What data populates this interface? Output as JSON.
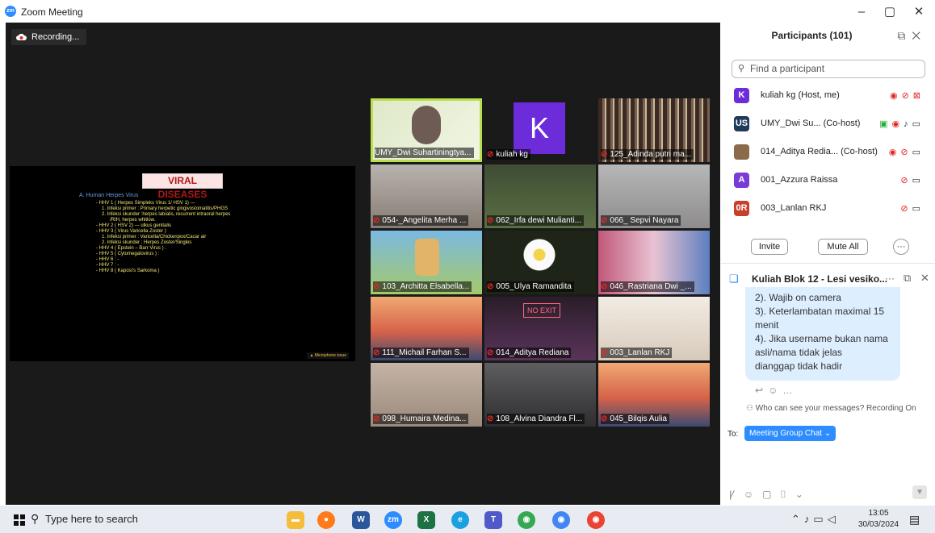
{
  "window": {
    "title": "Zoom Meeting",
    "minimize": "–",
    "maximize": "▢",
    "close": "✕"
  },
  "meeting": {
    "recording_label": "Recording...",
    "slide": {
      "title": "VIRAL DISEASES",
      "heading": "A. Human Herpes Virus",
      "lines": [
        "- HHV 1 ( Herpes Simpleks Virus 1/ HSV 1) ---",
        "1. Infeksi primer : Primary herpetic gingivostomatitis/PHGS",
        "2. Infeksi skunder :herpes labialis,  recurrent intraoral herpes",
        "/RIH, herpes whitlow.",
        "- HHV 2 ( HSV 2) --- ulkus genitalis",
        "- HHV 3 ( Virus Varicella Zoster )",
        "1. Infeksi primer : Varicella/Chickenpox/Cacar air",
        "2. Infeksi skunder : Herpes Zoster/Singles",
        "- HHV 4 ( Epstein – Barr  Virus ) :",
        "- HHV 5 ( Cytomegalovirus ) :",
        "- HHV 6 : -",
        "- HHV  7 : -",
        "- HHV  8 ( Kaposi's Sarkoma )"
      ],
      "note": "▲ Microphone issue"
    },
    "tiles": [
      {
        "name": "UMY_Dwi Suhartiningtya...",
        "muted": false
      },
      {
        "name": "kuliah kg",
        "muted": true,
        "initial": "K"
      },
      {
        "name": "125_Adinda putri ma...",
        "muted": true
      },
      {
        "name": "054-_Angelita Merha ...",
        "muted": true
      },
      {
        "name": "062_Irfa dewi Mulianti...",
        "muted": true
      },
      {
        "name": "066_ Sepvi Nayara",
        "muted": true
      },
      {
        "name": "103_Architta Elsabella...",
        "muted": true
      },
      {
        "name": "005_Ulya Ramandita",
        "muted": true
      },
      {
        "name": "046_Rastriana Dwi _...",
        "muted": true
      },
      {
        "name": "111_Michail Farhan S...",
        "muted": true
      },
      {
        "name": "014_Aditya Rediana",
        "muted": true
      },
      {
        "name": "003_Lanlan RKJ",
        "muted": true
      },
      {
        "name": "098_Humaira Medina...",
        "muted": true
      },
      {
        "name": "108_Alvina Diandra Fl...",
        "muted": true
      },
      {
        "name": "045_Bilqis Aulia",
        "muted": true
      }
    ]
  },
  "participants": {
    "title": "Participants (101)",
    "search_placeholder": "Find a participant",
    "list": [
      {
        "avatar": "K",
        "name": "kuliah kg (Host, me)",
        "color": "#6c2cd9"
      },
      {
        "avatar": "US",
        "name": "UMY_Dwi Su...  (Co-host)",
        "color": "#1f3a5c"
      },
      {
        "avatar": "",
        "name": "014_Aditya Redia...  (Co-host)",
        "color": "#8a6a4a"
      },
      {
        "avatar": "A",
        "name": "001_Azzura Raissa",
        "color": "#7a3cd6"
      },
      {
        "avatar": "0R",
        "name": "003_Lanlan RKJ",
        "color": "#c8402a"
      }
    ],
    "invite": "Invite",
    "mute_all": "Mute All",
    "more": "···"
  },
  "chat": {
    "title": "Kuliah Blok 12 - Lesi vesiko...",
    "more": "···",
    "messages": [
      "2). Wajib on camera",
      "3). Keterlambatan maximal 15",
      "menit",
      "4). Jika username bukan nama",
      "asli/nama tidak jelas",
      "dianggap tidak hadir"
    ],
    "recording_note": "Who can see your messages? Recording On",
    "to_label": "To:",
    "to_value": "Meeting Group Chat ⌄"
  },
  "taskbar": {
    "search": "Type here to search",
    "time": "13:05",
    "date": "30/03/2024"
  }
}
